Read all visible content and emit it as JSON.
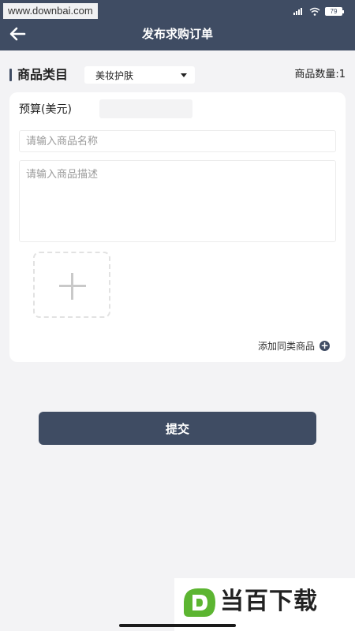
{
  "status_bar": {
    "watermark_text": "www.downbai.com",
    "battery_level": "79",
    "icons": [
      "signal-icon",
      "wifi-icon",
      "battery-icon"
    ]
  },
  "header": {
    "title": "发布求购订单",
    "back_icon": "arrow-left-icon"
  },
  "category": {
    "label": "商品类目",
    "selected": "美妆护肤",
    "quantity_text": "商品数量:1"
  },
  "form": {
    "budget_label": "预算(美元)",
    "budget_value": "",
    "name_placeholder": "请输入商品名称",
    "description_placeholder": "请输入商品描述",
    "upload_icon": "plus-icon",
    "add_similar_label": "添加同类商品"
  },
  "actions": {
    "submit_label": "提交"
  },
  "branding": {
    "logo_text": "当百下载"
  },
  "colors": {
    "primary": "#3f4c63",
    "background": "#f3f3f5",
    "card": "#ffffff",
    "logo_green": "#5cb531"
  }
}
